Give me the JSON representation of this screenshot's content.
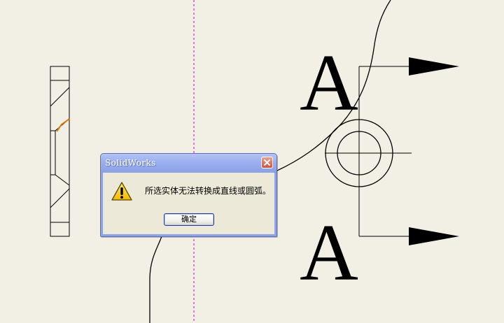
{
  "dialog": {
    "title": "SolidWorks",
    "message": "所选实体无法转换成直线或圆弧。",
    "ok_label": "确定",
    "icon": "warning-icon",
    "close_icon": "close-icon"
  },
  "drawing": {
    "section_label_top": "A",
    "section_label_bottom": "A"
  },
  "colors": {
    "background": "#f2f0e4",
    "construction_line": "#d400d4",
    "highlight_edge": "#e07a10",
    "dialog_frame": "#8fa3e8",
    "dialog_client": "#ece9d8",
    "close_button": "#c9573f"
  }
}
